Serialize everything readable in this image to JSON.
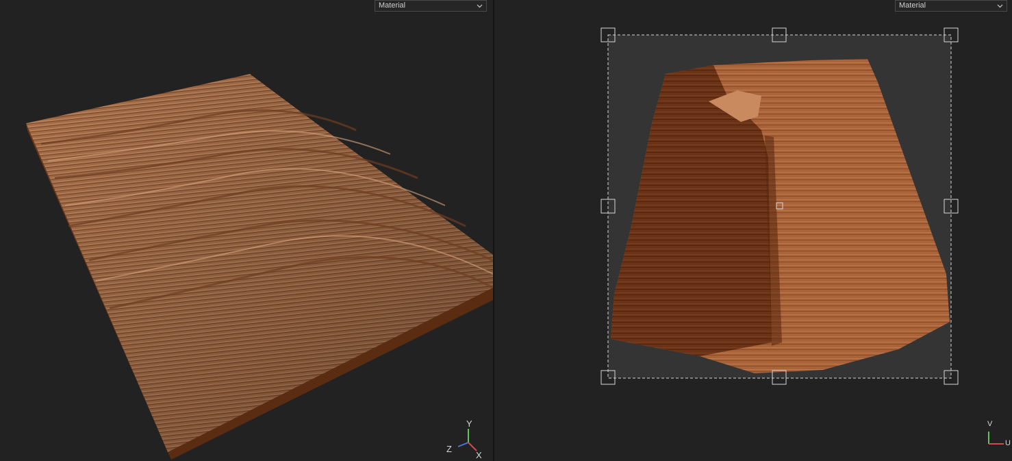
{
  "viewport_3d": {
    "shading_mode": "Material",
    "axis_labels": {
      "y": "Y",
      "z": "Z",
      "x": "X"
    }
  },
  "viewport_uv": {
    "shading_mode": "Material",
    "axis_labels": {
      "v": "V",
      "u": "U"
    }
  },
  "colors": {
    "background": "#222222",
    "wood_light": "#b77a52",
    "wood_dark": "#5a2c12",
    "selection_box": "#d8d8d8",
    "axis_x": "#d24a4a",
    "axis_y": "#5cc85c",
    "axis_z": "#5b6fd6"
  }
}
